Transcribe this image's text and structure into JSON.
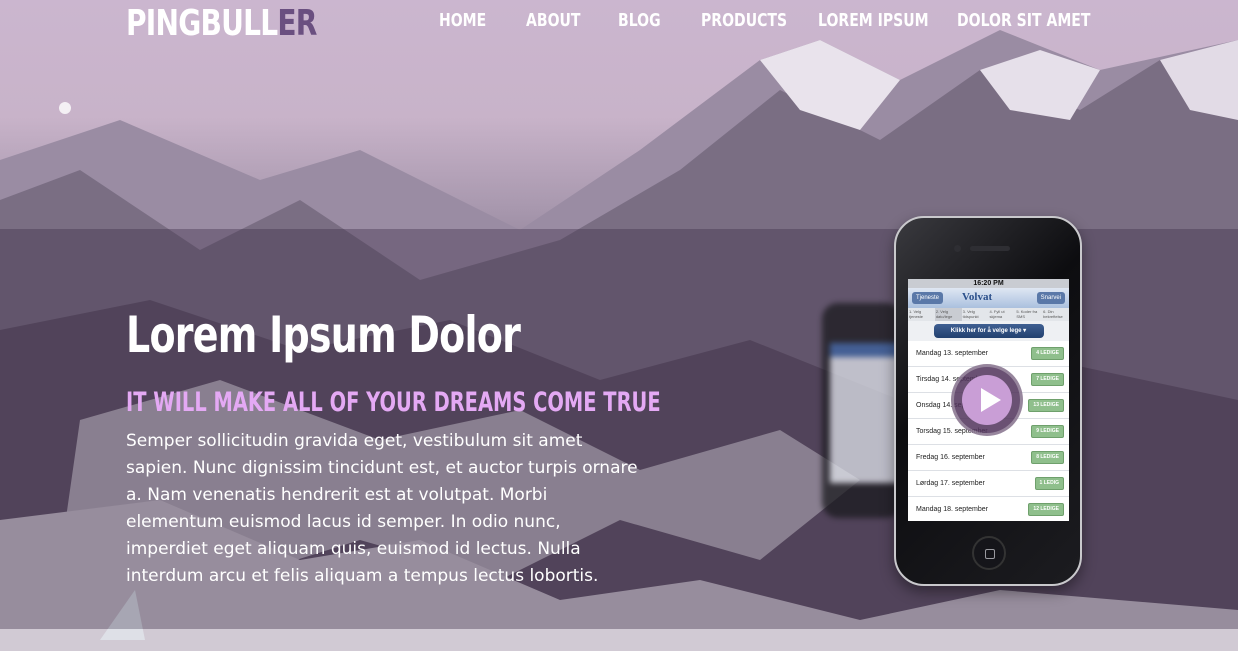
{
  "logo": {
    "part1": "PINGBULL",
    "part2": "ER"
  },
  "nav": {
    "items": [
      "HOME",
      "ABOUT",
      "BLOG",
      "PRODUCTS",
      "LOREM IPSUM",
      "DOLOR SIT AMET"
    ]
  },
  "hero": {
    "title": "Lorem Ipsum Dolor",
    "subtitle": "IT WILL MAKE ALL OF YOUR DREAMS COME TRUE",
    "body": "Semper sollicitudin gravida eget, vestibulum sit amet sapien. Nunc dignissim tincidunt est, et auctor turpis ornare a. Nam venenatis hendrerit est at volutpat. Morbi elementum euismod lacus id semper. In odio nunc, imperdiet eget aliquam quis, euismod id lectus. Nulla interdum arcu et felis aliquam a tempus lectus lobortis."
  },
  "phone": {
    "time": "16:20 PM",
    "left_button": "Tjeneste",
    "brand": "Volvat",
    "right_button": "Snarvei",
    "steps": [
      "1. Velg tjeneste",
      "2. Velg dato/lege",
      "3. Velg tidspunkt",
      "4. Fyll ut skjema",
      "5. Koder fra SMS",
      "6. Din bekreftelse"
    ],
    "cta": "Klikk her for å velge lege",
    "rows": [
      {
        "day": "Mandag 13. september",
        "badge": "4 LEDIGE"
      },
      {
        "day": "Tirsdag 14. september",
        "badge": "7 LEDIGE"
      },
      {
        "day": "Onsdag 14. september",
        "badge": "13 LEDIGE"
      },
      {
        "day": "Torsdag 15. september",
        "badge": "9 LEDIGE"
      },
      {
        "day": "Fredag 16. september",
        "badge": "8 LEDIGE"
      },
      {
        "day": "Lørdag 17. september",
        "badge": "1 LEDIG"
      },
      {
        "day": "Mandag 18. september",
        "badge": "12 LEDIGE"
      }
    ]
  },
  "colors": {
    "accent": "#e4a9f4",
    "logo_dark": "#6a4f80"
  }
}
